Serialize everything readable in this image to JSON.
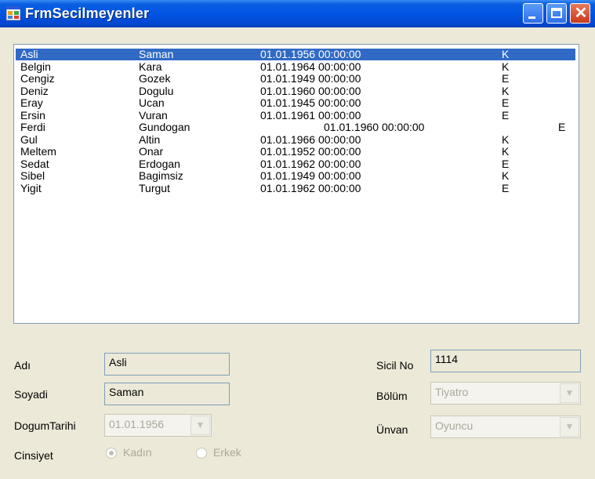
{
  "window": {
    "title": "FrmSecilmeyenler"
  },
  "list": {
    "rows": [
      [
        "Asli",
        "Saman",
        "01.01.1956 00:00:00",
        "K"
      ],
      [
        "Belgin",
        "Kara",
        "01.01.1964 00:00:00",
        "K"
      ],
      [
        "Cengiz",
        "Gozek",
        "01.01.1949 00:00:00",
        "E"
      ],
      [
        "Deniz",
        "Dogulu",
        "01.01.1960 00:00:00",
        "K"
      ],
      [
        "Eray",
        "Ucan",
        "01.01.1945 00:00:00",
        "E"
      ],
      [
        "Ersin",
        "Vuran",
        "01.01.1961 00:00:00",
        "E"
      ],
      [
        "Ferdi",
        "Gundogan",
        "01.01.1960 00:00:00",
        "E"
      ],
      [
        "Gul",
        "Altin",
        "01.01.1966 00:00:00",
        "K"
      ],
      [
        "Meltem",
        "Onar",
        "01.01.1952 00:00:00",
        "K"
      ],
      [
        "Sedat",
        "Erdogan",
        "01.01.1962 00:00:00",
        "E"
      ],
      [
        "Sibel",
        "Bagimsiz",
        "01.01.1949 00:00:00",
        "K"
      ],
      [
        "Yigit",
        "Turgut",
        "01.01.1962 00:00:00",
        "E"
      ]
    ],
    "selected_index": 0
  },
  "form": {
    "adi_label": "Adı",
    "adi_value": "Asli",
    "soyadi_label": "Soyadi",
    "soyadi_value": "Saman",
    "dogum_label": "DogumTarihi",
    "dogum_value": "01.01.1956",
    "cinsiyet_label": "Cinsiyet",
    "radio_kadin": "Kadın",
    "radio_erkek": "Erkek",
    "radio_selected": "Kadın",
    "sicil_label": "Sicil No",
    "sicil_value": "1114",
    "bolum_label": "Bölüm",
    "bolum_value": "Tiyatro",
    "unvan_label": "Ünvan",
    "unvan_value": "Oyuncu"
  },
  "colors": {
    "titlebar": "#0054e3",
    "selection": "#316ac5",
    "window_bg": "#ece9d8"
  },
  "icons": {
    "app": "form-icon",
    "minimize": "minimize-icon",
    "maximize": "maximize-icon",
    "close": "close-icon",
    "dropdown": "chevron-down-icon"
  }
}
